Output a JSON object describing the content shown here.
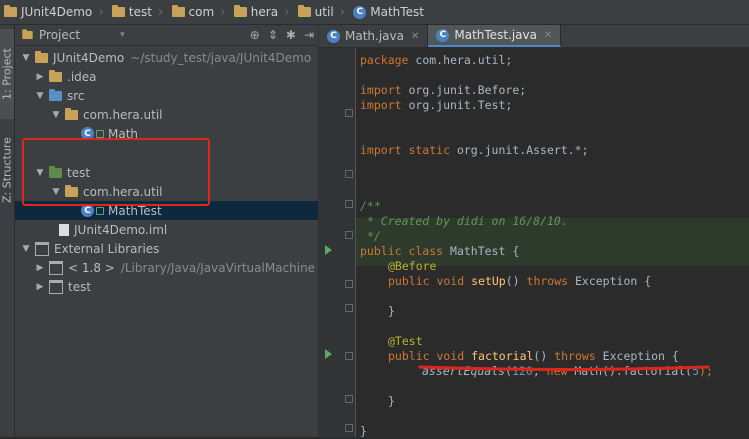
{
  "breadcrumb": {
    "items": [
      {
        "label": "JUnit4Demo",
        "icon": "folder-icon"
      },
      {
        "label": "test",
        "icon": "folder-icon"
      },
      {
        "label": "com",
        "icon": "folder-icon"
      },
      {
        "label": "hera",
        "icon": "folder-icon"
      },
      {
        "label": "util",
        "icon": "folder-icon"
      },
      {
        "label": "MathTest",
        "icon": "class-icon"
      }
    ]
  },
  "side_tabs": {
    "project": "1: Project",
    "structure": "Z: Structure"
  },
  "project_panel": {
    "view_label": "Project",
    "tree": [
      {
        "label": "JUnit4Demo",
        "detail": "~/study_test/java/JUnit4Demo"
      },
      {
        "label": ".idea"
      },
      {
        "label": "src"
      },
      {
        "label": "com.hera.util"
      },
      {
        "label": "Math"
      },
      {
        "label": "test"
      },
      {
        "label": "com.hera.util"
      },
      {
        "label": "MathTest"
      },
      {
        "label": "JUnit4Demo.iml"
      },
      {
        "label": "External Libraries"
      },
      {
        "label": "< 1.8 >",
        "detail": "/Library/Java/JavaVirtualMachine"
      },
      {
        "label": "test"
      }
    ]
  },
  "editor": {
    "tabs": [
      {
        "label": "Math.java"
      },
      {
        "label": "MathTest.java"
      }
    ],
    "code": {
      "l1_kw": "package",
      "l1_rest": " com.hera.util;",
      "l3_kw": "import",
      "l3_rest": " org.junit.Before;",
      "l4_kw": "import",
      "l4_rest": " org.junit.Test;",
      "l7_kw": "import static",
      "l7_rest": " org.junit.Assert.*;",
      "l9": "/**",
      "l10": " * Created by didi on 16/8/10.",
      "l11": " */",
      "l12_kw": "public class",
      "l12_rest": " MathTest {",
      "l13": "@Before",
      "l14_kw1": "public void",
      "l14_fn": "setUp",
      "l14_mid": "() ",
      "l14_kw2": "throws",
      "l14_rest": " Exception {",
      "l16": "}",
      "l18": "@Test",
      "l19_kw1": "public void",
      "l19_fn": "factorial",
      "l19_mid": "() ",
      "l19_kw2": "throws",
      "l19_rest": " Exception {",
      "l20_call": "assertEquals",
      "l20_open": "(",
      "l20_num1": "120",
      "l20_comma": ", ",
      "l20_kw": "new",
      "l20_mid": " Math().factorial(",
      "l20_num2": "5",
      "l20_end": ");",
      "l22": "}",
      "l24": "}"
    }
  },
  "colors": {
    "highlight_box": "#e0261c",
    "selection": "#0d293e",
    "keyword": "#cc7832"
  }
}
